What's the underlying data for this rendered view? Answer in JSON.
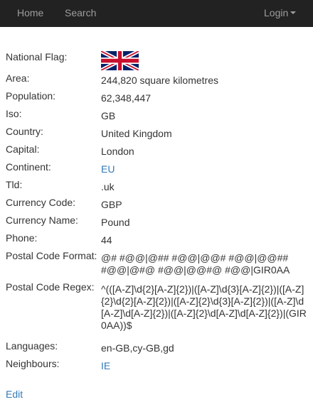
{
  "nav": {
    "home": "Home",
    "search": "Search",
    "login": "Login"
  },
  "country": {
    "flag_label": "National Flag:",
    "area_label": "Area:",
    "area": "244,820 square kilometres",
    "population_label": "Population:",
    "population": "62,348,447",
    "iso_label": "Iso:",
    "iso": "GB",
    "country_label": "Country:",
    "country": "United Kingdom",
    "capital_label": "Capital:",
    "capital": "London",
    "continent_label": "Continent:",
    "continent": "EU",
    "tld_label": "Tld:",
    "tld": ".uk",
    "currency_code_label": "Currency Code:",
    "currency_code": "GBP",
    "currency_name_label": "Currency Name:",
    "currency_name": "Pound",
    "phone_label": "Phone:",
    "phone": "44",
    "postal_format_label": "Postal Code Format:",
    "postal_format": "@# #@@|@## #@@|@@# #@@|@@## #@@|@#@ #@@|@@#@ #@@|GIR0AA",
    "postal_regex_label": "Postal Code Regex:",
    "postal_regex": "^(([A-Z]\\d{2}[A-Z]{2})|([A-Z]\\d{3}[A-Z]{2})|([A-Z]{2}\\d{2}[A-Z]{2})|([A-Z]{2}\\d{3}[A-Z]{2})|([A-Z]\\d[A-Z]\\d[A-Z]{2})|([A-Z]{2}\\d[A-Z]\\d[A-Z]{2})|(GIR0AA))$",
    "languages_label": "Languages:",
    "languages": "en-GB,cy-GB,gd",
    "neighbours_label": "Neighbours:",
    "neighbours": "IE"
  },
  "actions": {
    "edit": "Edit"
  },
  "colors": {
    "navbar": "#222222",
    "nav_text": "#9d9d9d",
    "link": "#337ab7"
  },
  "icons": {
    "flag": "uk-flag-icon",
    "login_caret": "caret-down-icon"
  }
}
